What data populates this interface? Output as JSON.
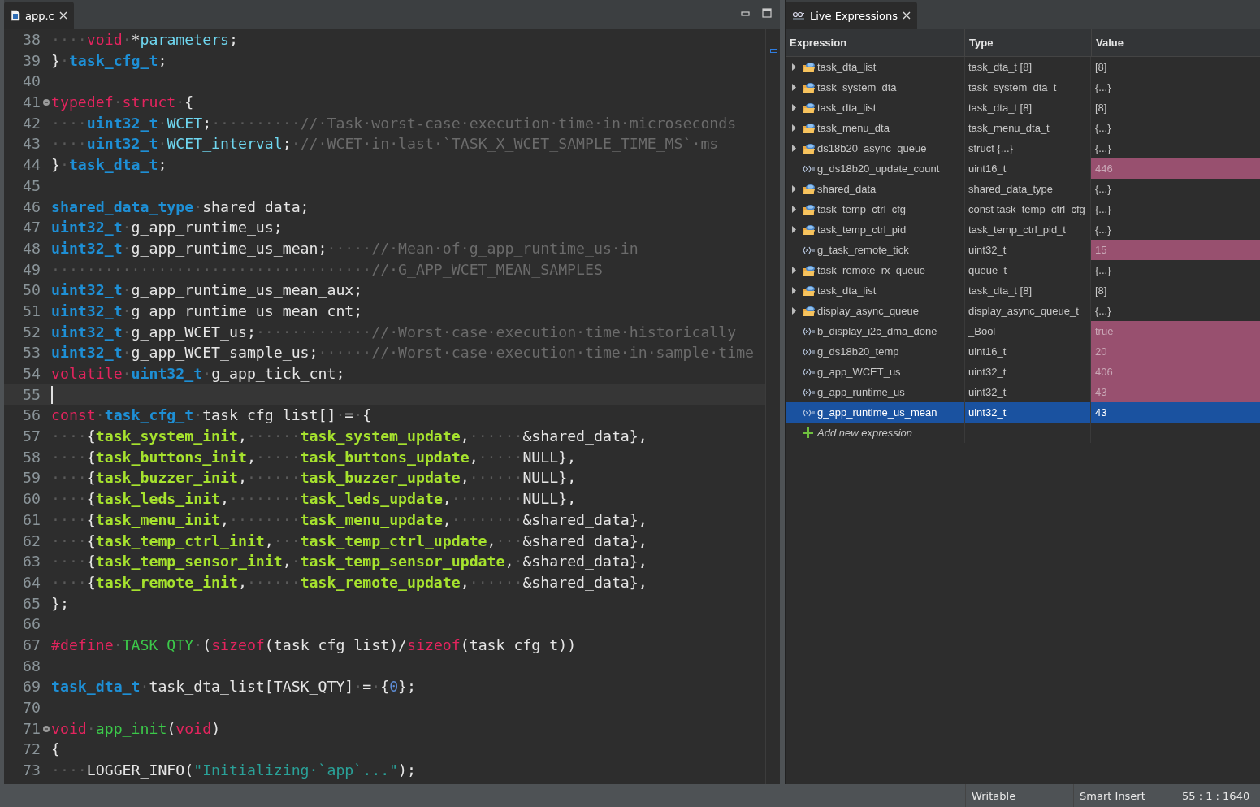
{
  "editor": {
    "tab": {
      "label": "app.c",
      "selected": true
    },
    "lines": [
      {
        "num": "38",
        "fold": false,
        "current": false,
        "tokens": [
          {
            "kind": "ws",
            "text": "····"
          },
          {
            "kind": "kw",
            "text": "void"
          },
          {
            "kind": "ws",
            "text": "·"
          },
          {
            "kind": "p",
            "text": "*"
          },
          {
            "kind": "fld",
            "text": "parameters"
          },
          {
            "kind": "p",
            "text": ";"
          }
        ]
      },
      {
        "num": "39",
        "fold": false,
        "current": false,
        "tokens": [
          {
            "kind": "p",
            "text": "}"
          },
          {
            "kind": "ws",
            "text": "·"
          },
          {
            "kind": "ty",
            "text": "task_cfg_t"
          },
          {
            "kind": "p",
            "text": ";"
          }
        ]
      },
      {
        "num": "40",
        "fold": false,
        "current": false
      },
      {
        "num": "41",
        "fold": true,
        "current": false,
        "tokens": [
          {
            "kind": "kw",
            "text": "typedef"
          },
          {
            "kind": "ws",
            "text": "·"
          },
          {
            "kind": "kw",
            "text": "struct"
          },
          {
            "kind": "ws",
            "text": "·"
          },
          {
            "kind": "p",
            "text": "{"
          }
        ]
      },
      {
        "num": "42",
        "fold": false,
        "current": false,
        "tokens": [
          {
            "kind": "ws",
            "text": "····"
          },
          {
            "kind": "ty",
            "text": "uint32_t"
          },
          {
            "kind": "ws",
            "text": "·"
          },
          {
            "kind": "fld",
            "text": "WCET"
          },
          {
            "kind": "p",
            "text": ";"
          },
          {
            "kind": "ws",
            "text": "··········"
          },
          {
            "kind": "cmt",
            "text": "//·Task·worst-case·execution·time·in·microseconds"
          }
        ]
      },
      {
        "num": "43",
        "fold": false,
        "current": false,
        "tokens": [
          {
            "kind": "ws",
            "text": "····"
          },
          {
            "kind": "ty",
            "text": "uint32_t"
          },
          {
            "kind": "ws",
            "text": "·"
          },
          {
            "kind": "fld",
            "text": "WCET_interval"
          },
          {
            "kind": "p",
            "text": ";"
          },
          {
            "kind": "ws",
            "text": "·"
          },
          {
            "kind": "cmt",
            "text": "//·WCET·in·last·`TASK_X_WCET_SAMPLE_TIME_MS`·ms"
          }
        ]
      },
      {
        "num": "44",
        "fold": false,
        "current": false,
        "tokens": [
          {
            "kind": "p",
            "text": "}"
          },
          {
            "kind": "ws",
            "text": "·"
          },
          {
            "kind": "ty",
            "text": "task_dta_t"
          },
          {
            "kind": "p",
            "text": ";"
          }
        ]
      },
      {
        "num": "45",
        "fold": false,
        "current": false
      },
      {
        "num": "46",
        "fold": false,
        "current": false,
        "tokens": [
          {
            "kind": "ty",
            "text": "shared_data_type"
          },
          {
            "kind": "ws",
            "text": "·"
          },
          {
            "kind": "p",
            "text": "shared_data;"
          }
        ]
      },
      {
        "num": "47",
        "fold": false,
        "current": false,
        "tokens": [
          {
            "kind": "ty",
            "text": "uint32_t"
          },
          {
            "kind": "ws",
            "text": "·"
          },
          {
            "kind": "p",
            "text": "g_app_runtime_us;"
          }
        ]
      },
      {
        "num": "48",
        "fold": false,
        "current": false,
        "tokens": [
          {
            "kind": "ty",
            "text": "uint32_t"
          },
          {
            "kind": "ws",
            "text": "·"
          },
          {
            "kind": "p",
            "text": "g_app_runtime_us_mean;"
          },
          {
            "kind": "ws",
            "text": "·····"
          },
          {
            "kind": "cmt",
            "text": "//·Mean·of·g_app_runtime_us·in"
          }
        ]
      },
      {
        "num": "49",
        "fold": false,
        "current": false,
        "tokens": [
          {
            "kind": "ws",
            "text": "····································"
          },
          {
            "kind": "cmt",
            "text": "//·G_APP_WCET_MEAN_SAMPLES"
          }
        ]
      },
      {
        "num": "50",
        "fold": false,
        "current": false,
        "tokens": [
          {
            "kind": "ty",
            "text": "uint32_t"
          },
          {
            "kind": "ws",
            "text": "·"
          },
          {
            "kind": "p",
            "text": "g_app_runtime_us_mean_aux;"
          }
        ]
      },
      {
        "num": "51",
        "fold": false,
        "current": false,
        "tokens": [
          {
            "kind": "ty",
            "text": "uint32_t"
          },
          {
            "kind": "ws",
            "text": "·"
          },
          {
            "kind": "p",
            "text": "g_app_runtime_us_mean_cnt;"
          }
        ]
      },
      {
        "num": "52",
        "fold": false,
        "current": false,
        "tokens": [
          {
            "kind": "ty",
            "text": "uint32_t"
          },
          {
            "kind": "ws",
            "text": "·"
          },
          {
            "kind": "p",
            "text": "g_app_WCET_us;"
          },
          {
            "kind": "ws",
            "text": "·············"
          },
          {
            "kind": "cmt",
            "text": "//·Worst·case·execution·time·historically"
          }
        ]
      },
      {
        "num": "53",
        "fold": false,
        "current": false,
        "tokens": [
          {
            "kind": "ty",
            "text": "uint32_t"
          },
          {
            "kind": "ws",
            "text": "·"
          },
          {
            "kind": "p",
            "text": "g_app_WCET_sample_us;"
          },
          {
            "kind": "ws",
            "text": "······"
          },
          {
            "kind": "cmt",
            "text": "//·Worst·case·execution·time·in·sample·time"
          }
        ]
      },
      {
        "num": "54",
        "fold": false,
        "current": false,
        "tokens": [
          {
            "kind": "kw",
            "text": "volatile"
          },
          {
            "kind": "ws",
            "text": "·"
          },
          {
            "kind": "ty",
            "text": "uint32_t"
          },
          {
            "kind": "ws",
            "text": "·"
          },
          {
            "kind": "p",
            "text": "g_app_tick_cnt;"
          }
        ]
      },
      {
        "num": "55",
        "fold": false,
        "current": true
      },
      {
        "num": "56",
        "fold": false,
        "current": false,
        "tokens": [
          {
            "kind": "kw",
            "text": "const"
          },
          {
            "kind": "ws",
            "text": "·"
          },
          {
            "kind": "ty",
            "text": "task_cfg_t"
          },
          {
            "kind": "ws",
            "text": "·"
          },
          {
            "kind": "p",
            "text": "task_cfg_list[]"
          },
          {
            "kind": "ws",
            "text": "·"
          },
          {
            "kind": "p",
            "text": "="
          },
          {
            "kind": "ws",
            "text": "·"
          },
          {
            "kind": "p",
            "text": "{"
          }
        ]
      },
      {
        "num": "57",
        "fold": false,
        "current": false,
        "tokens": [
          {
            "kind": "ws",
            "text": "····"
          },
          {
            "kind": "p",
            "text": "{"
          },
          {
            "kind": "fn",
            "text": "task_system_init"
          },
          {
            "kind": "p",
            "text": ","
          },
          {
            "kind": "ws",
            "text": "······"
          },
          {
            "kind": "fn",
            "text": "task_system_update"
          },
          {
            "kind": "p",
            "text": ","
          },
          {
            "kind": "ws",
            "text": "······"
          },
          {
            "kind": "p",
            "text": "&shared_data},"
          }
        ]
      },
      {
        "num": "58",
        "fold": false,
        "current": false,
        "tokens": [
          {
            "kind": "ws",
            "text": "····"
          },
          {
            "kind": "p",
            "text": "{"
          },
          {
            "kind": "fn",
            "text": "task_buttons_init"
          },
          {
            "kind": "p",
            "text": ","
          },
          {
            "kind": "ws",
            "text": "·····"
          },
          {
            "kind": "fn",
            "text": "task_buttons_update"
          },
          {
            "kind": "p",
            "text": ","
          },
          {
            "kind": "ws",
            "text": "·····"
          },
          {
            "kind": "p",
            "text": "NULL},"
          }
        ]
      },
      {
        "num": "59",
        "fold": false,
        "current": false,
        "tokens": [
          {
            "kind": "ws",
            "text": "····"
          },
          {
            "kind": "p",
            "text": "{"
          },
          {
            "kind": "fn",
            "text": "task_buzzer_init"
          },
          {
            "kind": "p",
            "text": ","
          },
          {
            "kind": "ws",
            "text": "······"
          },
          {
            "kind": "fn",
            "text": "task_buzzer_update"
          },
          {
            "kind": "p",
            "text": ","
          },
          {
            "kind": "ws",
            "text": "······"
          },
          {
            "kind": "p",
            "text": "NULL},"
          }
        ]
      },
      {
        "num": "60",
        "fold": false,
        "current": false,
        "tokens": [
          {
            "kind": "ws",
            "text": "····"
          },
          {
            "kind": "p",
            "text": "{"
          },
          {
            "kind": "fn",
            "text": "task_leds_init"
          },
          {
            "kind": "p",
            "text": ","
          },
          {
            "kind": "ws",
            "text": "········"
          },
          {
            "kind": "fn",
            "text": "task_leds_update"
          },
          {
            "kind": "p",
            "text": ","
          },
          {
            "kind": "ws",
            "text": "········"
          },
          {
            "kind": "p",
            "text": "NULL},"
          }
        ]
      },
      {
        "num": "61",
        "fold": false,
        "current": false,
        "tokens": [
          {
            "kind": "ws",
            "text": "····"
          },
          {
            "kind": "p",
            "text": "{"
          },
          {
            "kind": "fn",
            "text": "task_menu_init"
          },
          {
            "kind": "p",
            "text": ","
          },
          {
            "kind": "ws",
            "text": "········"
          },
          {
            "kind": "fn",
            "text": "task_menu_update"
          },
          {
            "kind": "p",
            "text": ","
          },
          {
            "kind": "ws",
            "text": "········"
          },
          {
            "kind": "p",
            "text": "&shared_data},"
          }
        ]
      },
      {
        "num": "62",
        "fold": false,
        "current": false,
        "tokens": [
          {
            "kind": "ws",
            "text": "····"
          },
          {
            "kind": "p",
            "text": "{"
          },
          {
            "kind": "fn",
            "text": "task_temp_ctrl_init"
          },
          {
            "kind": "p",
            "text": ","
          },
          {
            "kind": "ws",
            "text": "···"
          },
          {
            "kind": "fn",
            "text": "task_temp_ctrl_update"
          },
          {
            "kind": "p",
            "text": ","
          },
          {
            "kind": "ws",
            "text": "···"
          },
          {
            "kind": "p",
            "text": "&shared_data},"
          }
        ]
      },
      {
        "num": "63",
        "fold": false,
        "current": false,
        "tokens": [
          {
            "kind": "ws",
            "text": "····"
          },
          {
            "kind": "p",
            "text": "{"
          },
          {
            "kind": "fn",
            "text": "task_temp_sensor_init"
          },
          {
            "kind": "p",
            "text": ","
          },
          {
            "kind": "ws",
            "text": "·"
          },
          {
            "kind": "fn",
            "text": "task_temp_sensor_update"
          },
          {
            "kind": "p",
            "text": ","
          },
          {
            "kind": "ws",
            "text": "·"
          },
          {
            "kind": "p",
            "text": "&shared_data},"
          }
        ]
      },
      {
        "num": "64",
        "fold": false,
        "current": false,
        "tokens": [
          {
            "kind": "ws",
            "text": "····"
          },
          {
            "kind": "p",
            "text": "{"
          },
          {
            "kind": "fn",
            "text": "task_remote_init"
          },
          {
            "kind": "p",
            "text": ","
          },
          {
            "kind": "ws",
            "text": "······"
          },
          {
            "kind": "fn",
            "text": "task_remote_update"
          },
          {
            "kind": "p",
            "text": ","
          },
          {
            "kind": "ws",
            "text": "······"
          },
          {
            "kind": "p",
            "text": "&shared_data},"
          }
        ]
      },
      {
        "num": "65",
        "fold": false,
        "current": false,
        "tokens": [
          {
            "kind": "p",
            "text": "};"
          }
        ]
      },
      {
        "num": "66",
        "fold": false,
        "current": false
      },
      {
        "num": "67",
        "fold": false,
        "current": false,
        "tokens": [
          {
            "kind": "kw",
            "text": "#define"
          },
          {
            "kind": "ws",
            "text": "·"
          },
          {
            "kind": "mac",
            "text": "TASK_QTY"
          },
          {
            "kind": "ws",
            "text": "·"
          },
          {
            "kind": "p",
            "text": "("
          },
          {
            "kind": "kw",
            "text": "sizeof"
          },
          {
            "kind": "p",
            "text": "(task_cfg_list)/"
          },
          {
            "kind": "kw",
            "text": "sizeof"
          },
          {
            "kind": "p",
            "text": "(task_cfg_t))"
          }
        ]
      },
      {
        "num": "68",
        "fold": false,
        "current": false
      },
      {
        "num": "69",
        "fold": false,
        "current": false,
        "tokens": [
          {
            "kind": "ty",
            "text": "task_dta_t"
          },
          {
            "kind": "ws",
            "text": "·"
          },
          {
            "kind": "p",
            "text": "task_dta_list[TASK_QTY]"
          },
          {
            "kind": "ws",
            "text": "·"
          },
          {
            "kind": "p",
            "text": "="
          },
          {
            "kind": "ws",
            "text": "·"
          },
          {
            "kind": "p",
            "text": "{"
          },
          {
            "kind": "num",
            "text": "0"
          },
          {
            "kind": "p",
            "text": "};"
          }
        ]
      },
      {
        "num": "70",
        "fold": false,
        "current": false
      },
      {
        "num": "71",
        "fold": true,
        "current": false,
        "tokens": [
          {
            "kind": "kw",
            "text": "void"
          },
          {
            "kind": "ws",
            "text": "·"
          },
          {
            "kind": "mac",
            "text": "app_init"
          },
          {
            "kind": "p",
            "text": "("
          },
          {
            "kind": "kw",
            "text": "void"
          },
          {
            "kind": "p",
            "text": ")"
          }
        ]
      },
      {
        "num": "72",
        "fold": false,
        "current": false,
        "tokens": [
          {
            "kind": "p",
            "text": "{"
          }
        ]
      },
      {
        "num": "73",
        "fold": false,
        "current": false,
        "tokens": [
          {
            "kind": "ws",
            "text": "····"
          },
          {
            "kind": "p",
            "text": "LOGGER_INFO("
          },
          {
            "kind": "str",
            "text": "\"Initializing·`app`...\""
          },
          {
            "kind": "p",
            "text": ");"
          }
        ]
      }
    ]
  },
  "live_expressions": {
    "tab": {
      "label": "Live Expressions",
      "selected": true
    },
    "columns": [
      "Expression",
      "Type",
      "Value"
    ],
    "rows": [
      {
        "kind": "struct",
        "expression": "task_dta_list",
        "type": "task_dta_t [8]",
        "value": "[8]",
        "changed": false,
        "selected": false
      },
      {
        "kind": "struct",
        "expression": "task_system_dta",
        "type": "task_system_dta_t",
        "value": "{...}",
        "changed": false,
        "selected": false
      },
      {
        "kind": "struct",
        "expression": "task_dta_list",
        "type": "task_dta_t [8]",
        "value": "[8]",
        "changed": false,
        "selected": false
      },
      {
        "kind": "struct",
        "expression": "task_menu_dta",
        "type": "task_menu_dta_t",
        "value": "{...}",
        "changed": false,
        "selected": false
      },
      {
        "kind": "struct",
        "expression": "ds18b20_async_queue",
        "type": "struct {...}",
        "value": "{...}",
        "changed": false,
        "selected": false
      },
      {
        "kind": "variable",
        "expression": "g_ds18b20_update_count",
        "type": "uint16_t",
        "value": "446",
        "changed": true,
        "selected": false
      },
      {
        "kind": "struct",
        "expression": "shared_data",
        "type": "shared_data_type",
        "value": "{...}",
        "changed": false,
        "selected": false
      },
      {
        "kind": "struct",
        "expression": "task_temp_ctrl_cfg",
        "type": "const task_temp_ctrl_cfg",
        "value": "{...}",
        "changed": false,
        "selected": false
      },
      {
        "kind": "struct",
        "expression": "task_temp_ctrl_pid",
        "type": "task_temp_ctrl_pid_t",
        "value": "{...}",
        "changed": false,
        "selected": false
      },
      {
        "kind": "variable",
        "expression": "g_task_remote_tick",
        "type": "uint32_t",
        "value": "15",
        "changed": true,
        "selected": false
      },
      {
        "kind": "struct",
        "expression": "task_remote_rx_queue",
        "type": "queue_t",
        "value": "{...}",
        "changed": false,
        "selected": false
      },
      {
        "kind": "struct",
        "expression": "task_dta_list",
        "type": "task_dta_t [8]",
        "value": "[8]",
        "changed": false,
        "selected": false
      },
      {
        "kind": "struct",
        "expression": "display_async_queue",
        "type": "display_async_queue_t",
        "value": "{...}",
        "changed": false,
        "selected": false
      },
      {
        "kind": "variable",
        "expression": "b_display_i2c_dma_done",
        "type": "_Bool",
        "value": "true",
        "changed": true,
        "selected": false
      },
      {
        "kind": "variable",
        "expression": "g_ds18b20_temp",
        "type": "uint16_t",
        "value": "20",
        "changed": true,
        "selected": false
      },
      {
        "kind": "variable",
        "expression": "g_app_WCET_us",
        "type": "uint32_t",
        "value": "406",
        "changed": true,
        "selected": false
      },
      {
        "kind": "variable",
        "expression": "g_app_runtime_us",
        "type": "uint32_t",
        "value": "43",
        "changed": true,
        "selected": false
      },
      {
        "kind": "variable",
        "expression": "g_app_runtime_us_mean",
        "type": "uint32_t",
        "value": "43",
        "changed": false,
        "selected": true
      }
    ],
    "add_row": "Add new expression"
  },
  "status_bar": {
    "items": [
      "Writable",
      "Smart Insert",
      "55 : 1 : 1640"
    ]
  }
}
